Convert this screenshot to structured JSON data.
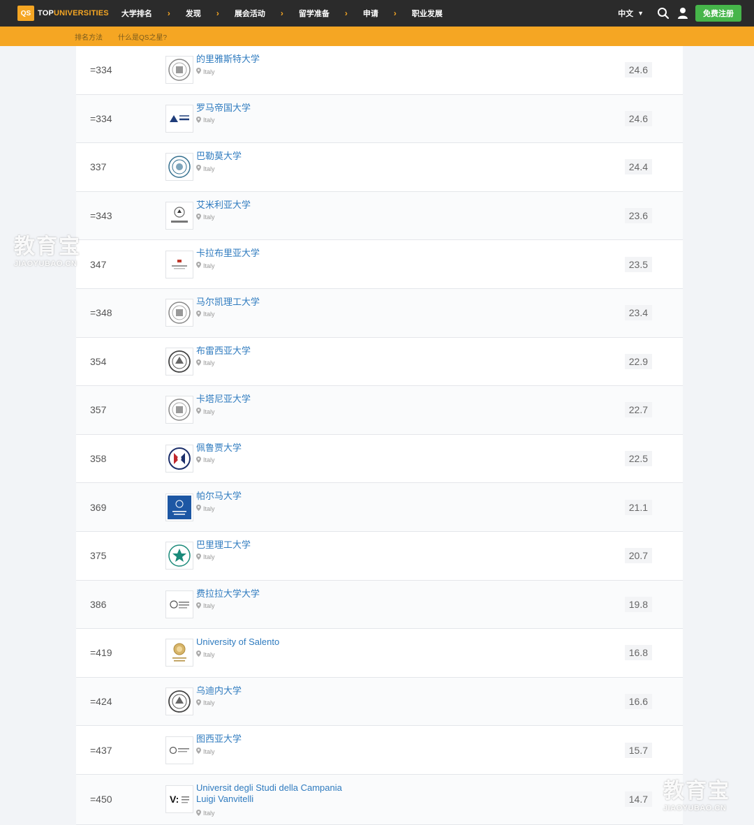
{
  "nav": {
    "logo_badge": "QS",
    "logo_text_1": "TOP",
    "logo_text_2": "UNIVERSITIES",
    "items": [
      "大学排名",
      "发现",
      "展会活动",
      "留学准备",
      "申请",
      "职业发展"
    ],
    "language": "中文",
    "signup": "免费注册"
  },
  "subnav": {
    "items": [
      "排名方法",
      "什么是QS之星?"
    ]
  },
  "rows": [
    {
      "rank": "=334",
      "name": "的里雅斯特大学",
      "country": "Italy",
      "score": "24.6",
      "logo": "seal-grey"
    },
    {
      "rank": "=334",
      "name": "罗马帝国大学",
      "country": "Italy",
      "score": "24.6",
      "logo": "roma-tre"
    },
    {
      "rank": "337",
      "name": "巴勒莫大学",
      "country": "Italy",
      "score": "24.4",
      "logo": "seal-blue"
    },
    {
      "rank": "=343",
      "name": "艾米利亚大学",
      "country": "Italy",
      "score": "23.6",
      "logo": "unimore"
    },
    {
      "rank": "347",
      "name": "卡拉布里亚大学",
      "country": "Italy",
      "score": "23.5",
      "logo": "calabria"
    },
    {
      "rank": "=348",
      "name": "马尔凯理工大学",
      "country": "Italy",
      "score": "23.4",
      "logo": "seal-grey"
    },
    {
      "rank": "354",
      "name": "布雷西亚大学",
      "country": "Italy",
      "score": "22.9",
      "logo": "seal-dark"
    },
    {
      "rank": "357",
      "name": "卡塔尼亚大学",
      "country": "Italy",
      "score": "22.7",
      "logo": "seal-grey"
    },
    {
      "rank": "358",
      "name": "佩鲁贾大学",
      "country": "Italy",
      "score": "22.5",
      "logo": "perugia"
    },
    {
      "rank": "369",
      "name": "帕尔马大学",
      "country": "Italy",
      "score": "21.1",
      "logo": "parma"
    },
    {
      "rank": "375",
      "name": "巴里理工大学",
      "country": "Italy",
      "score": "20.7",
      "logo": "bari"
    },
    {
      "rank": "386",
      "name": "费拉拉大学大学",
      "country": "Italy",
      "score": "19.8",
      "logo": "ferrara"
    },
    {
      "rank": "=419",
      "name": "University of Salento",
      "country": "Italy",
      "score": "16.8",
      "logo": "salento"
    },
    {
      "rank": "=424",
      "name": "乌迪内大学",
      "country": "Italy",
      "score": "16.6",
      "logo": "seal-dark"
    },
    {
      "rank": "=437",
      "name": "图西亚大学",
      "country": "Italy",
      "score": "15.7",
      "logo": "tuscia"
    },
    {
      "rank": "=450",
      "name": "Universit degli Studi della Campania Luigi Vanvitelli",
      "country": "Italy",
      "score": "14.7",
      "logo": "vanvitelli"
    }
  ],
  "watermarks": [
    {
      "big": "教育宝",
      "small": "JIAOYUBAO.CN"
    },
    {
      "big": "教育宝",
      "small": "JIAOYUBAO.CN"
    }
  ],
  "colors": {
    "accent": "#f5a623",
    "link": "#2f7bbf",
    "signup": "#46b54a",
    "nav": "#2b2b2b"
  }
}
